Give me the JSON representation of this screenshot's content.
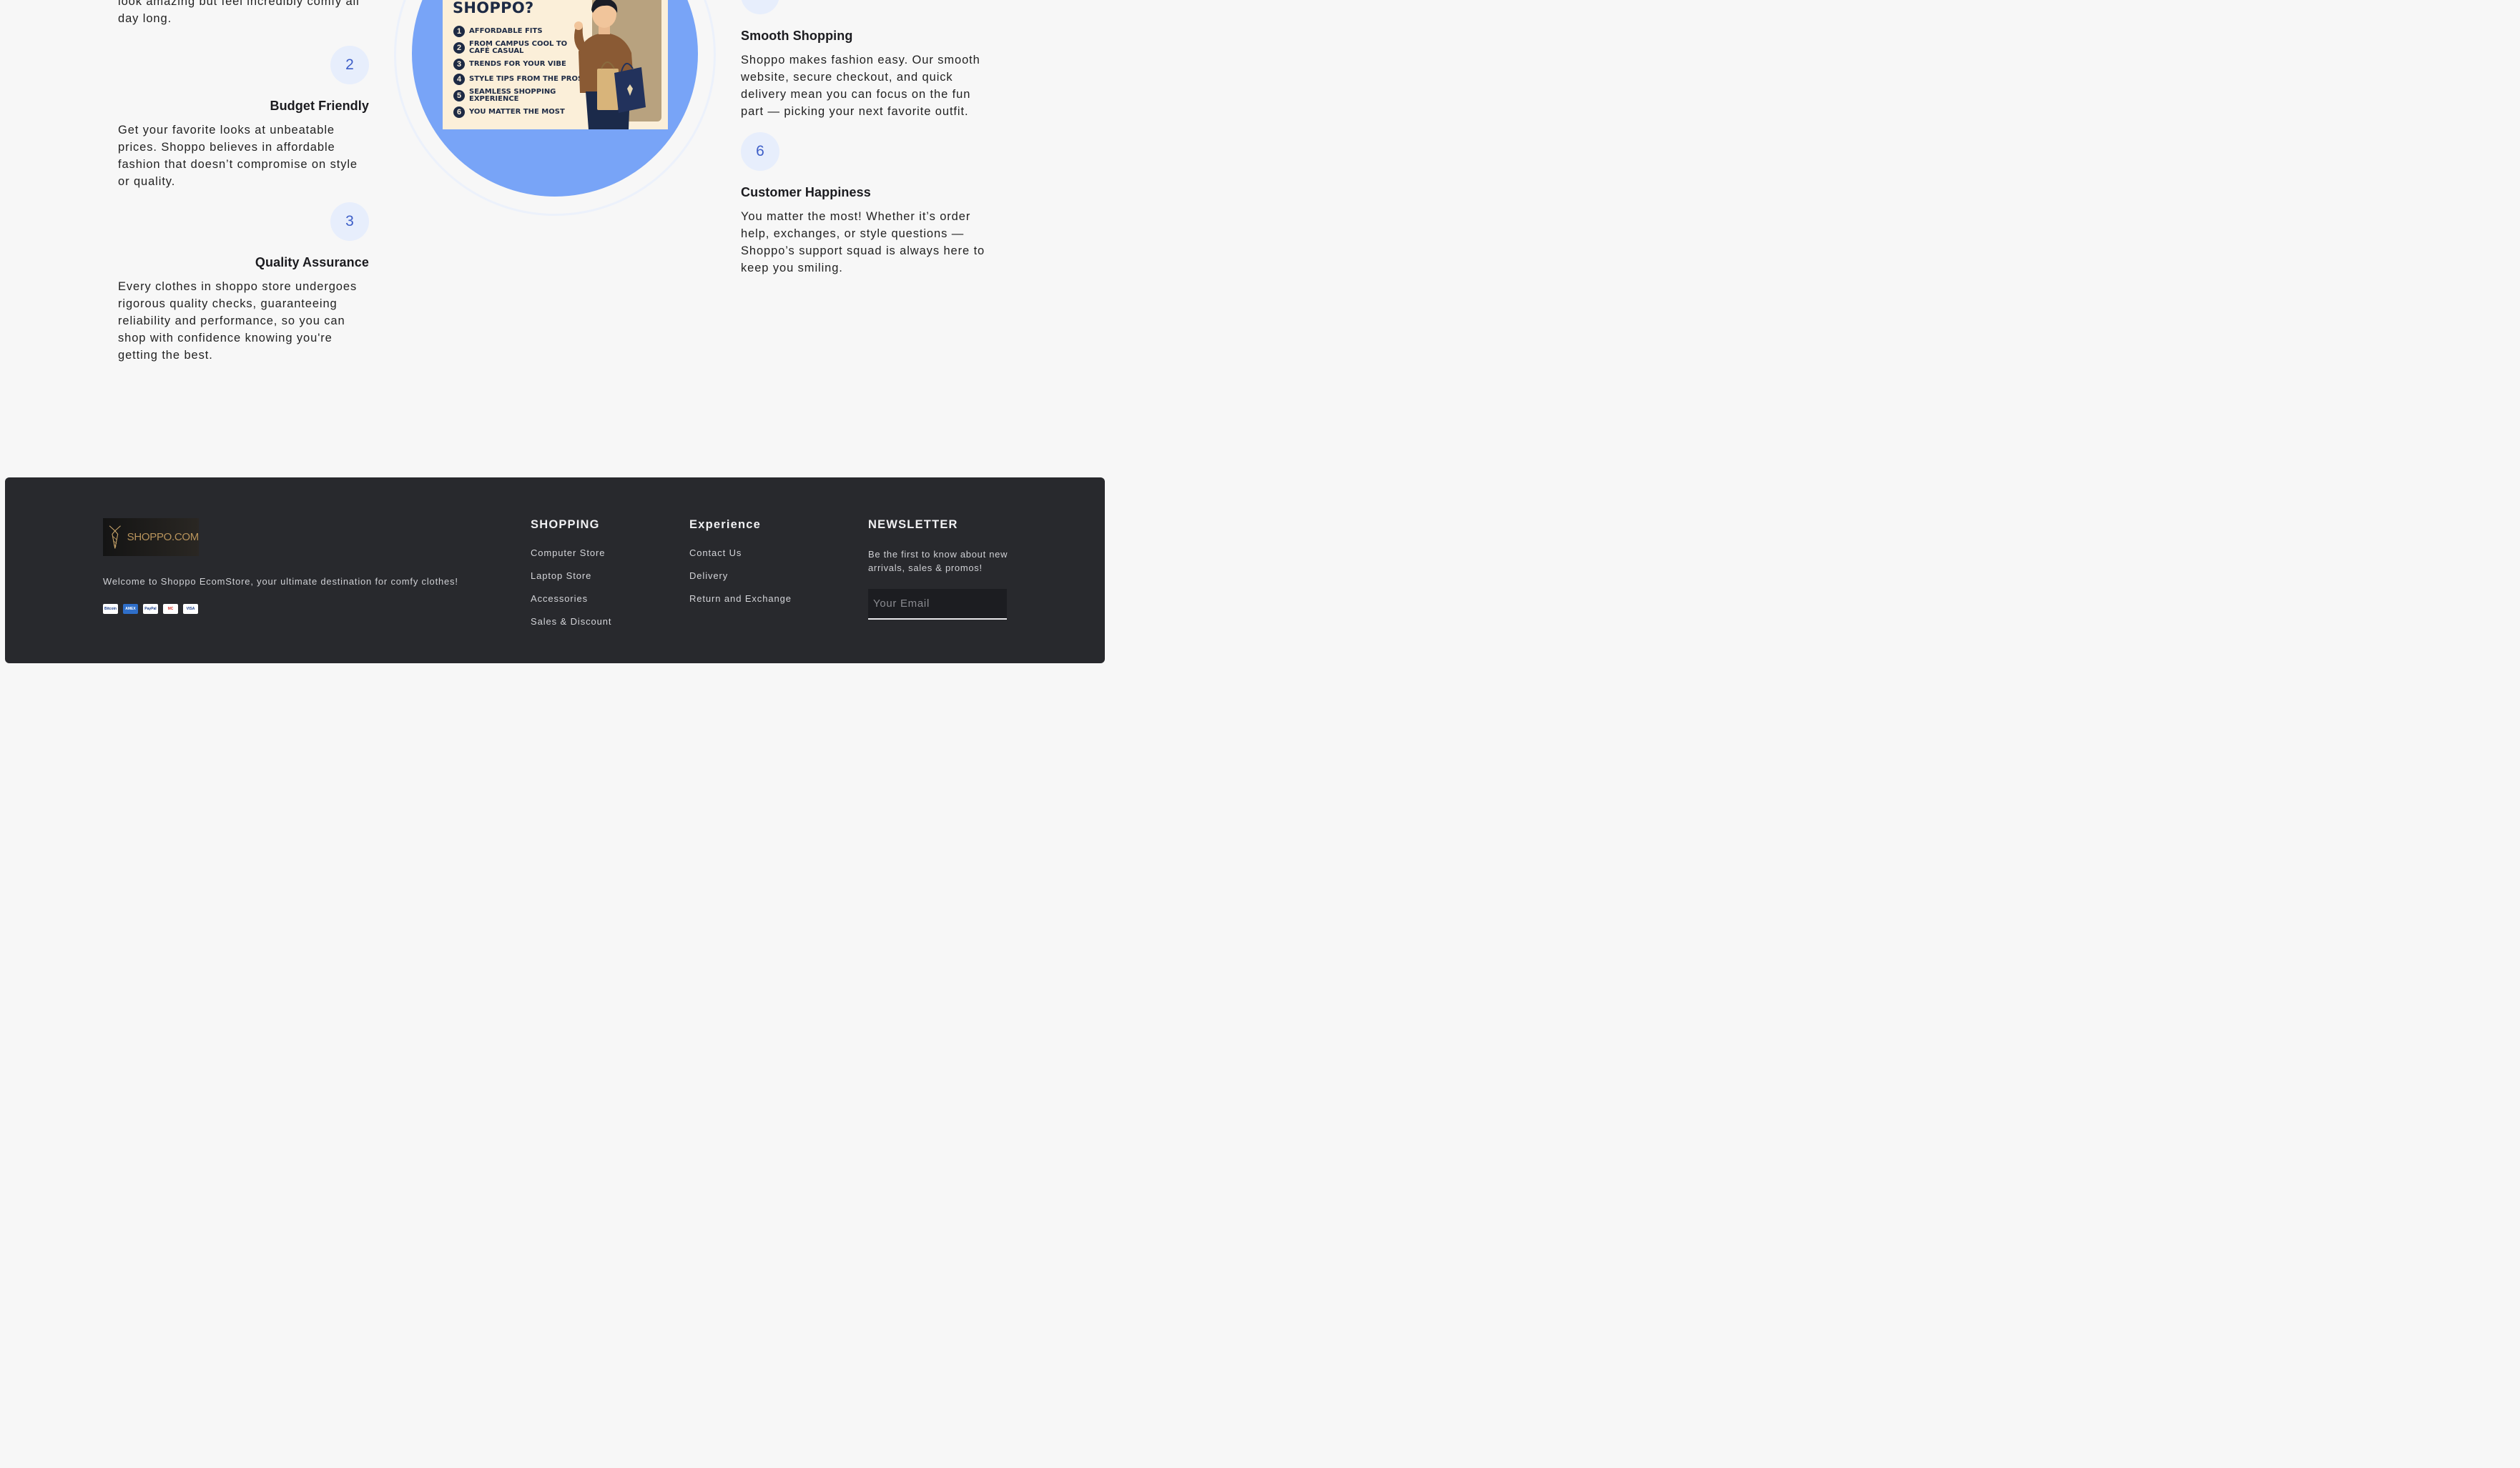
{
  "features_left": [
    {
      "desc_tail": "look amazing but feel incredibly comfy all day long."
    },
    {
      "number": "2",
      "title": "Budget Friendly",
      "desc": "Get your favorite looks at unbeatable prices. Shoppo believes in affordable fashion that doesn’t compromise on style or quality."
    },
    {
      "number": "3",
      "title": "Quality Assurance",
      "desc": "Every clothes in shoppo store undergoes rigorous quality checks, guaranteeing reliability and performance, so you can shop with confidence knowing you're getting the best."
    }
  ],
  "features_right": [
    {
      "title": "Smooth Shopping",
      "desc": "Shoppo makes fashion easy. Our smooth website, secure checkout, and quick delivery mean you can focus on the fun part — picking your next favorite outfit."
    },
    {
      "number": "6",
      "title": "Customer Happiness",
      "desc": "You matter the most! Whether it’s order help, exchanges, or style questions — Shoppo’s support squad is always here to keep you smiling."
    }
  ],
  "poster": {
    "title": "WHY CHOOSE SHOPPO?",
    "items": [
      {
        "n": "1",
        "text": "Affordable Fits"
      },
      {
        "n": "2",
        "text": "From Campus Cool to Café Casual"
      },
      {
        "n": "3",
        "text": "Trends for Your Vibe"
      },
      {
        "n": "4",
        "text": "Style Tips from the Pros"
      },
      {
        "n": "5",
        "text": "Seamless Shopping Experience"
      },
      {
        "n": "6",
        "text": "You Matter the Most"
      }
    ]
  },
  "footer": {
    "logo_text": "SHOPPO.COM",
    "welcome": "Welcome to Shoppo EcomStore, your ultimate destination for comfy clothes!",
    "payment_icons": [
      "bitcoin-icon",
      "amex-icon",
      "paypal-icon",
      "mastercard-icon",
      "visa-icon"
    ],
    "payment_labels": [
      "Bitcoin",
      "AMEX",
      "PayPal",
      "MC",
      "VISA"
    ],
    "shopping": {
      "heading": "SHOPPING",
      "links": [
        "Computer Store",
        "Laptop Store",
        "Accessories",
        "Sales & Discount"
      ]
    },
    "experience": {
      "heading": "Experience",
      "links": [
        "Contact Us",
        "Delivery",
        "Return and Exchange"
      ]
    },
    "newsletter": {
      "heading": "NEWSLETTER",
      "text": "Be the first to know about new arrivals, sales & promos!",
      "placeholder": "Your Email"
    }
  },
  "colors": {
    "accent_blue": "#78a4f7",
    "badge_bg": "#e7eefc",
    "badge_text": "#3e5fc8",
    "footer_bg": "#28292d"
  }
}
